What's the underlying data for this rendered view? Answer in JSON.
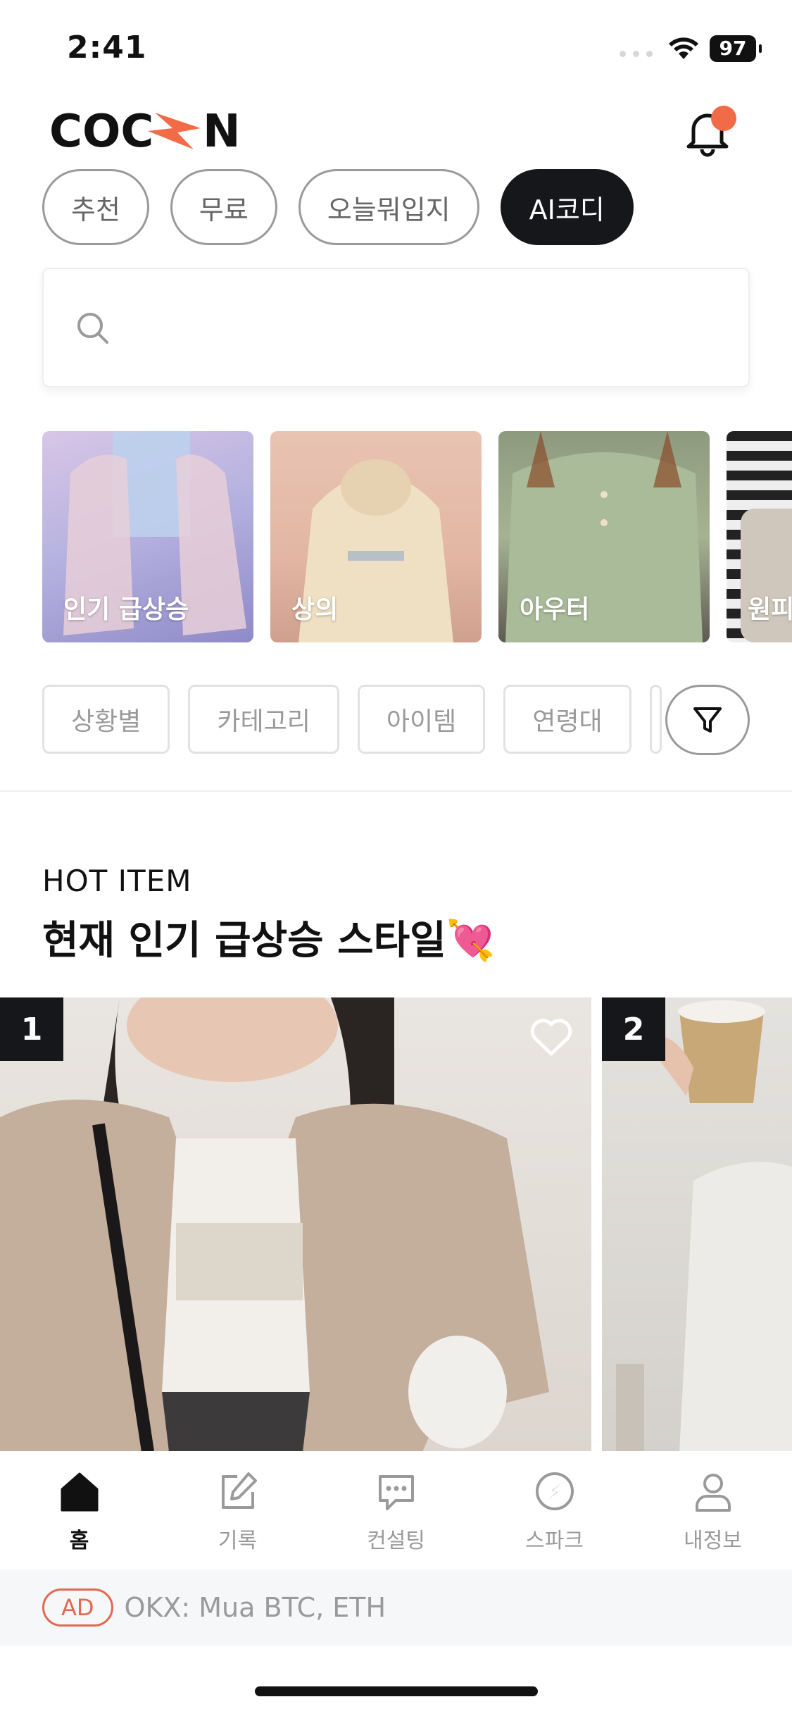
{
  "status": {
    "time": "2:41",
    "battery": "97"
  },
  "header": {
    "logo": "COCON"
  },
  "tabs": [
    {
      "label": "추천",
      "active": false
    },
    {
      "label": "무료",
      "active": false
    },
    {
      "label": "오늘뭐입지",
      "active": false
    },
    {
      "label": "AI코디",
      "active": true
    }
  ],
  "search": {
    "placeholder": ""
  },
  "categories": [
    {
      "label": "인기 급상승"
    },
    {
      "label": "상의"
    },
    {
      "label": "아우터"
    },
    {
      "label": "원피"
    }
  ],
  "filters": [
    "상황별",
    "카테고리",
    "아이템",
    "연령대"
  ],
  "hot": {
    "label": "HOT ITEM",
    "title": "현재 인기 급상승 스타일💘"
  },
  "products": [
    {
      "rank": "1"
    },
    {
      "rank": "2"
    }
  ],
  "nav": [
    {
      "label": "홈",
      "icon": "home-icon",
      "active": true
    },
    {
      "label": "기록",
      "icon": "edit-icon",
      "active": false
    },
    {
      "label": "컨설팅",
      "icon": "chat-icon",
      "active": false
    },
    {
      "label": "스파크",
      "icon": "compass-icon",
      "active": false
    },
    {
      "label": "내정보",
      "icon": "user-icon",
      "active": false
    }
  ],
  "ad": {
    "badge": "AD",
    "text": "OKX: Mua BTC, ETH"
  },
  "colors": {
    "accent": "#f06b46",
    "dark": "#16171b",
    "muted": "#9a9a9a"
  }
}
